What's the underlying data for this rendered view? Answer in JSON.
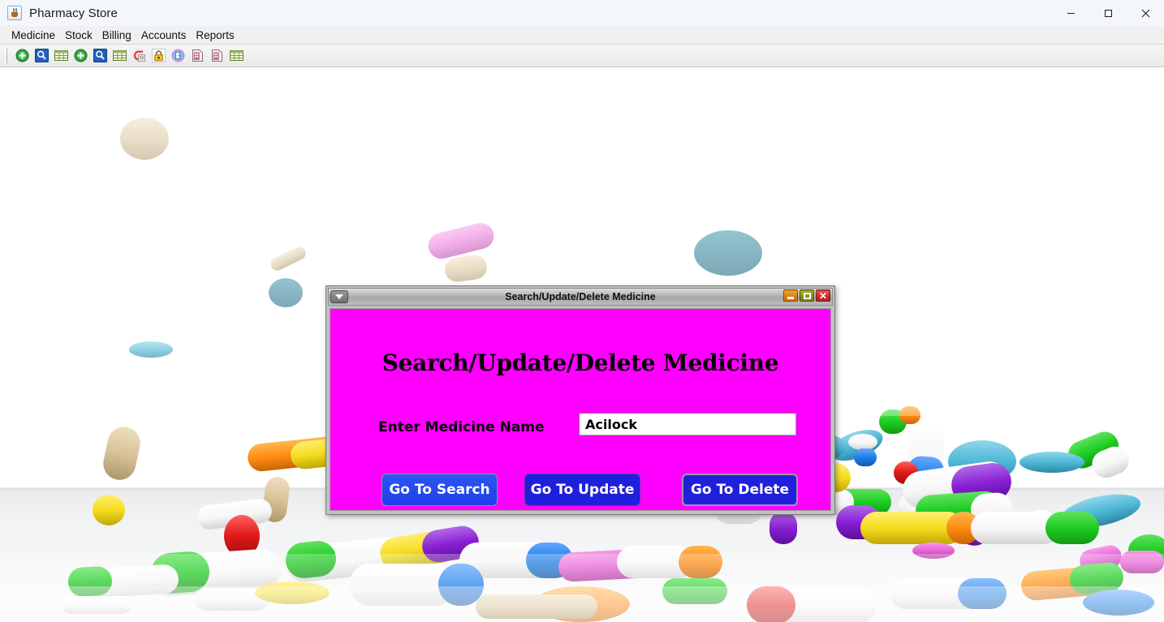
{
  "window": {
    "title": "Pharmacy Store",
    "app_icon": "java-coffee-cup-icon",
    "controls": {
      "minimize": "minimize-icon",
      "maximize": "maximize-icon",
      "close": "close-icon"
    }
  },
  "menubar": {
    "items": [
      {
        "label": "Medicine"
      },
      {
        "label": "Stock"
      },
      {
        "label": "Billing"
      },
      {
        "label": "Accounts"
      },
      {
        "label": "Reports"
      }
    ]
  },
  "toolbar": {
    "buttons": [
      {
        "icon": "add-green-plus-icon"
      },
      {
        "icon": "search-magnifier-icon"
      },
      {
        "icon": "table-grid-icon"
      },
      {
        "icon": "add-green-plus-icon"
      },
      {
        "icon": "search-magnifier-icon"
      },
      {
        "icon": "table-grid-icon"
      },
      {
        "icon": "refund-red-icon"
      },
      {
        "icon": "lock-yellow-icon"
      },
      {
        "icon": "exit-door-icon"
      },
      {
        "icon": "report-document-icon"
      },
      {
        "icon": "report-document-icon"
      },
      {
        "icon": "table-grid-icon"
      }
    ]
  },
  "desktop": {
    "background": "pills-capsules-photo-background"
  },
  "dialog": {
    "title": "Search/Update/Delete Medicine",
    "system_menu_icon": "chevron-down-icon",
    "controls": {
      "minimize": "minimize-icon",
      "maximize": "maximize-icon",
      "close": "close-icon",
      "close_glyph": "✕"
    },
    "heading": "Search/Update/Delete Medicine",
    "form": {
      "label": "Enter Medicine Name",
      "value": "Acilock",
      "placeholder": ""
    },
    "buttons": {
      "search": "Go To Search",
      "update": "Go To Update",
      "delete": "Go To Delete"
    },
    "colors": {
      "background": "#FF00FF",
      "button_fill": "#1F1FDC",
      "button_hover": "#2F56F2",
      "text": "#FFFFFF"
    }
  }
}
